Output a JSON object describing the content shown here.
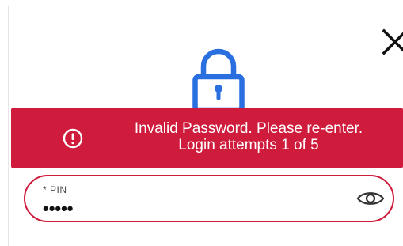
{
  "dialog": {
    "close_icon": "close-icon",
    "lock_icon": "lock-icon"
  },
  "error": {
    "icon": "alert-circle-icon",
    "line1": "Invalid Password. Please re-enter.",
    "line2": "Login attempts 1 of 5",
    "color": "#cf1b3c"
  },
  "pin": {
    "label": "* PIN",
    "value": "•••••",
    "eye_icon": "eye-icon"
  },
  "colors": {
    "accent_blue": "#2a6fe0",
    "error_red": "#cf1b3c"
  }
}
